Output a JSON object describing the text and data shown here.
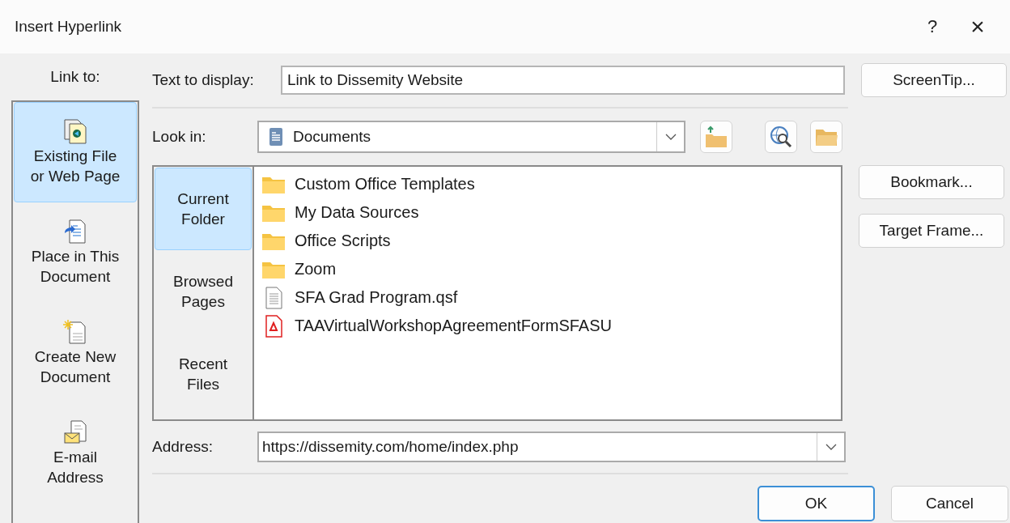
{
  "window": {
    "title": "Insert Hyperlink",
    "help": "?",
    "close": "×"
  },
  "link_to": {
    "label": "Link to:",
    "items": [
      {
        "label": "Existing File or Web Page",
        "kind": "file",
        "selected": true
      },
      {
        "label": "Place in This Document",
        "kind": "place",
        "selected": false
      },
      {
        "label": "Create New Document",
        "kind": "new",
        "selected": false
      },
      {
        "label": "E-mail Address",
        "kind": "email",
        "selected": false
      }
    ]
  },
  "text_to_display": {
    "label": "Text to display:",
    "value": "Link to Dissemity Website"
  },
  "look_in": {
    "label": "Look in:",
    "value": "Documents"
  },
  "browse_nav": [
    {
      "label": "Current Folder",
      "selected": true
    },
    {
      "label": "Browsed Pages",
      "selected": false
    },
    {
      "label": "Recent Files",
      "selected": false
    }
  ],
  "files": [
    {
      "name": "Custom Office Templates",
      "kind": "folder"
    },
    {
      "name": "My Data Sources",
      "kind": "folder"
    },
    {
      "name": "Office Scripts",
      "kind": "folder"
    },
    {
      "name": "Zoom",
      "kind": "folder"
    },
    {
      "name": "SFA Grad Program.qsf",
      "kind": "file"
    },
    {
      "name": "TAAVirtualWorkshopAgreementFormSFASU",
      "kind": "pdf"
    }
  ],
  "address": {
    "label": "Address:",
    "value": "https://dissemity.com/home/index.php"
  },
  "side_buttons": [
    "ScreenTip...",
    "Bookmark...",
    "Target Frame..."
  ],
  "buttons": [
    {
      "label": "OK",
      "default": true
    },
    {
      "label": "Cancel",
      "default": false
    }
  ]
}
